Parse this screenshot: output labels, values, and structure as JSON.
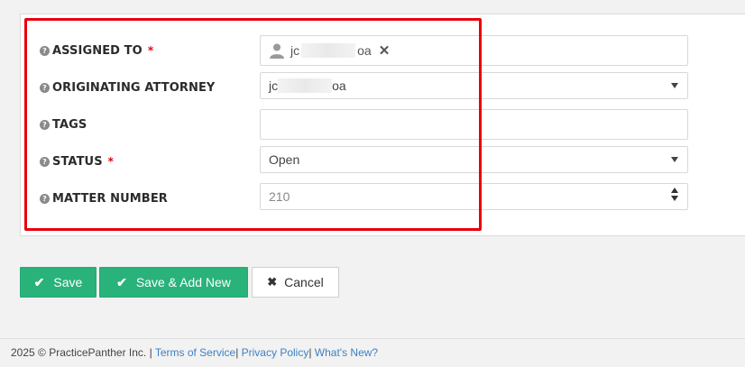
{
  "form": {
    "fields": [
      {
        "label": "ASSIGNED TO",
        "required": true,
        "value_prefix": "jc",
        "value_suffix": "oa",
        "type": "tag"
      },
      {
        "label": "ORIGINATING ATTORNEY",
        "required": false,
        "value_prefix": "jc",
        "value_suffix": "oa",
        "type": "select"
      },
      {
        "label": "TAGS",
        "required": false,
        "value": "",
        "type": "text"
      },
      {
        "label": "STATUS",
        "required": true,
        "value": "Open",
        "type": "select"
      },
      {
        "label": "MATTER NUMBER",
        "required": false,
        "value": "210",
        "type": "number"
      }
    ],
    "help_glyph": "?",
    "required_mark": "*",
    "remove_glyph": "✕"
  },
  "actions": {
    "save": "Save",
    "save_add_new": "Save & Add New",
    "cancel": "Cancel"
  },
  "footer": {
    "copyright": "2025 © PracticePanther Inc. | ",
    "terms": "Terms of Service",
    "sep1": "| ",
    "privacy": "Privacy Policy",
    "sep2": "| ",
    "whats_new": "What's New?"
  },
  "colors": {
    "highlight": "#e8000b",
    "primary_button": "#2ab27b",
    "link": "#3b82c4",
    "required": "#e8000b"
  },
  "icons": {
    "help": "question-circle-icon",
    "user": "person-icon",
    "remove": "close-icon",
    "check": "check-icon",
    "cancel": "x-icon",
    "dropdown": "caret-down-icon",
    "spinner": "number-spinner-icon"
  }
}
